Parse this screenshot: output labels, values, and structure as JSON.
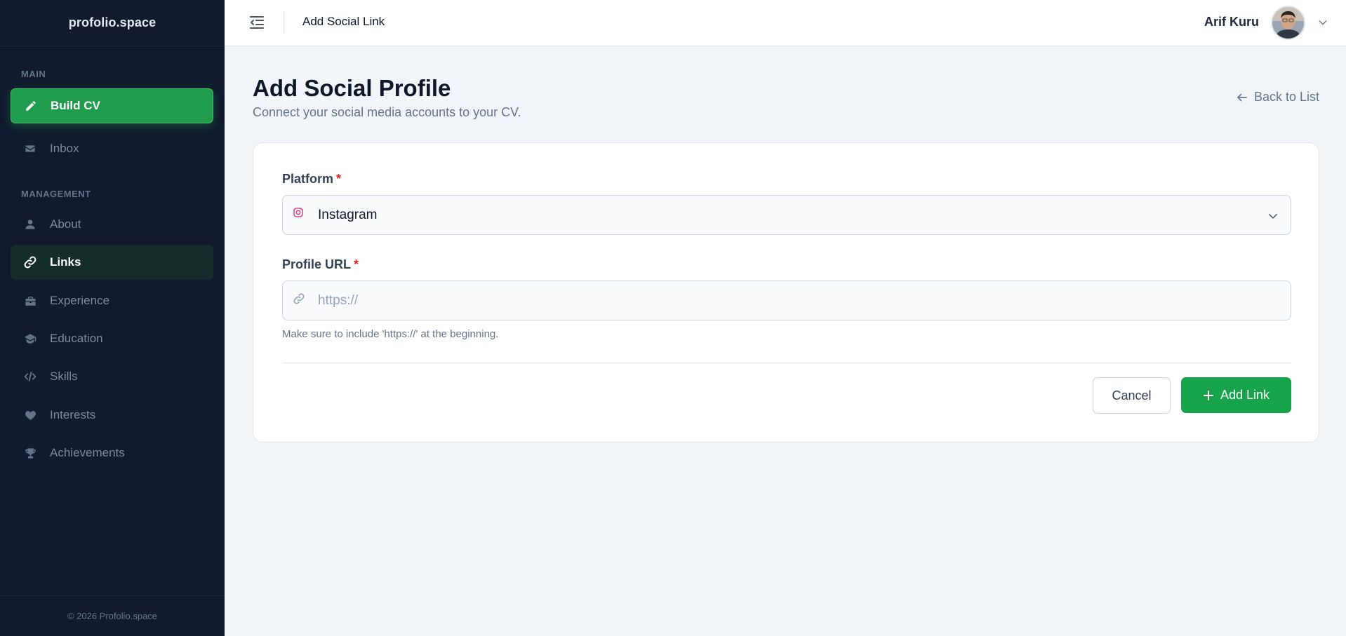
{
  "brand": {
    "name": "profolio.space"
  },
  "sidebar": {
    "sections": [
      {
        "label": "MAIN"
      },
      {
        "label": "MANAGEMENT"
      }
    ],
    "items": [
      {
        "label": "Build CV",
        "icon": "pencil-icon"
      },
      {
        "label": "Inbox",
        "icon": "envelope-icon"
      },
      {
        "label": "About",
        "icon": "user-icon"
      },
      {
        "label": "Links",
        "icon": "link-icon"
      },
      {
        "label": "Experience",
        "icon": "briefcase-icon"
      },
      {
        "label": "Education",
        "icon": "graduation-cap-icon"
      },
      {
        "label": "Skills",
        "icon": "code-icon"
      },
      {
        "label": "Interests",
        "icon": "heart-icon"
      },
      {
        "label": "Achievements",
        "icon": "trophy-icon"
      }
    ],
    "active_item": "Links",
    "footer": "© 2026 Profolio.space"
  },
  "topbar": {
    "title": "Add Social Link",
    "user_name": "Arif Kuru"
  },
  "page": {
    "title": "Add Social Profile",
    "subtitle": "Connect your social media accounts to your CV.",
    "back_label": "Back to List"
  },
  "form": {
    "platform": {
      "label": "Platform",
      "required": "*",
      "value": "Instagram",
      "icon": "instagram-icon"
    },
    "profile_url": {
      "label": "Profile URL",
      "required": "*",
      "placeholder": "https://",
      "icon": "link-icon",
      "help": "Make sure to include 'https://' at the beginning."
    },
    "cancel_label": "Cancel",
    "submit_label": "Add Link"
  },
  "colors": {
    "sidebar_bg": "#111a2e",
    "accent": "#16a34a",
    "active_item_bg": "#142d2b",
    "required": "#dc2626",
    "instagram": "#db2777"
  }
}
